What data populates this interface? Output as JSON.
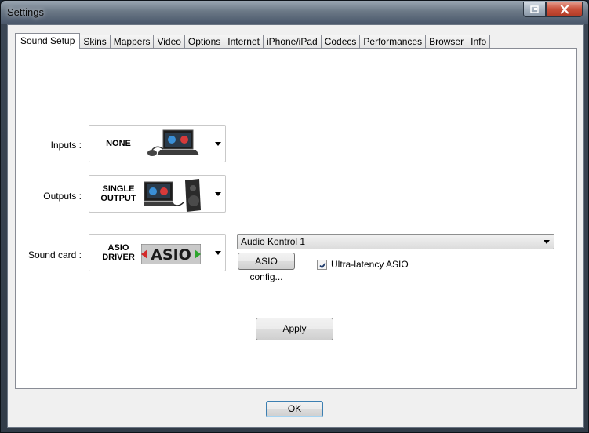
{
  "window": {
    "title": "Settings"
  },
  "tabs": [
    {
      "label": "Sound Setup",
      "active": true
    },
    {
      "label": "Skins"
    },
    {
      "label": "Mappers"
    },
    {
      "label": "Video"
    },
    {
      "label": "Options"
    },
    {
      "label": "Internet"
    },
    {
      "label": "iPhone/iPad"
    },
    {
      "label": "Codecs"
    },
    {
      "label": "Performances"
    },
    {
      "label": "Browser"
    },
    {
      "label": "Info"
    }
  ],
  "sound_setup": {
    "inputs": {
      "label": "Inputs :",
      "value": "NONE"
    },
    "outputs": {
      "label": "Outputs :",
      "value_line1": "SINGLE",
      "value_line2": "OUTPUT"
    },
    "sound_card": {
      "label": "Sound card :",
      "value_line1": "ASIO",
      "value_line2": "DRIVER",
      "logo_text": "ASIO"
    },
    "device": {
      "selected": "Audio Kontrol 1"
    },
    "asio_config_label": "ASIO config...",
    "ultra_latency": {
      "label": "Ultra-latency ASIO",
      "checked": true
    },
    "apply_label": "Apply"
  },
  "footer": {
    "ok_label": "OK"
  },
  "colors": {
    "close_button": "#c9503a",
    "ok_border": "#3c7fb1"
  }
}
